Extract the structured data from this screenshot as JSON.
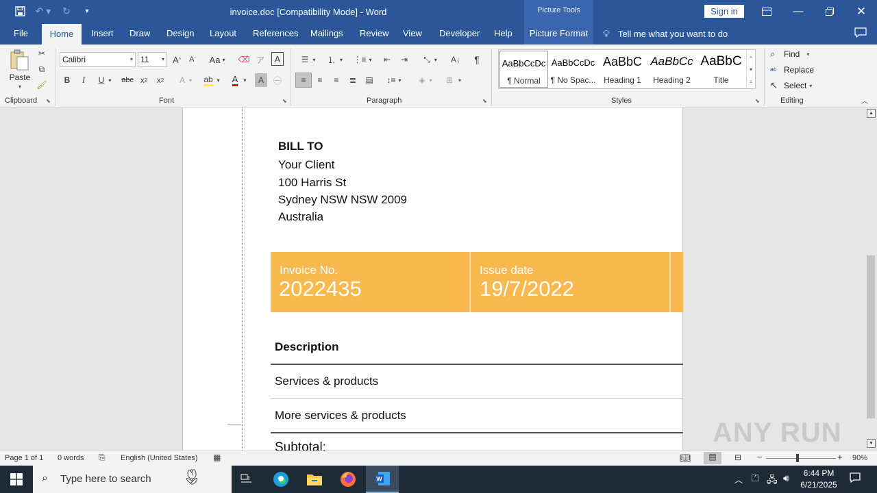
{
  "titlebar": {
    "title": "invoice.doc [Compatibility Mode]  -  Word",
    "picture_tools": "Picture Tools",
    "sign_in": "Sign in"
  },
  "tabs": [
    {
      "label": "File"
    },
    {
      "label": "Home"
    },
    {
      "label": "Insert"
    },
    {
      "label": "Draw"
    },
    {
      "label": "Design"
    },
    {
      "label": "Layout"
    },
    {
      "label": "References"
    },
    {
      "label": "Mailings"
    },
    {
      "label": "Review"
    },
    {
      "label": "View"
    },
    {
      "label": "Developer"
    },
    {
      "label": "Help"
    },
    {
      "label": "Picture Format"
    }
  ],
  "tell_me": "Tell me what you want to do",
  "ribbon": {
    "clipboard": {
      "label": "Clipboard",
      "paste": "Paste"
    },
    "font": {
      "label": "Font",
      "family": "Calibri",
      "size": "11",
      "aa": "Aa"
    },
    "paragraph": {
      "label": "Paragraph"
    },
    "styles": {
      "label": "Styles",
      "items": [
        {
          "sample": "AaBbCcDc",
          "name": "¶ Normal"
        },
        {
          "sample": "AaBbCcDc",
          "name": "¶ No Spac..."
        },
        {
          "sample": "AaBbC",
          "name": "Heading 1"
        },
        {
          "sample": "AaBbCc",
          "name": "Heading 2"
        },
        {
          "sample": "AaBbC",
          "name": "Title"
        }
      ]
    },
    "editing": {
      "label": "Editing",
      "find": "Find",
      "replace": "Replace",
      "select": "Select"
    }
  },
  "document": {
    "bill_to": "BILL TO",
    "client": "Your Client",
    "street": "100 Harris St",
    "city": "Sydney NSW NSW 2009",
    "country": "Australia",
    "invoice_no_label": "Invoice No.",
    "invoice_no": "2022435",
    "issue_date_label": "Issue date",
    "issue_date": "19/7/2022",
    "description": "Description",
    "row1": "Services & products",
    "row2": "More services & products",
    "subtotal": "Subtotal:"
  },
  "statusbar": {
    "page": "Page 1 of 1",
    "words": "0 words",
    "language": "English (United States)",
    "zoom": "90%"
  },
  "taskbar": {
    "search_placeholder": "Type here to search",
    "time": "6:44 PM",
    "date": "6/21/2025"
  },
  "watermark": "ANY RUN",
  "colors": {
    "word_blue": "#2b579a",
    "invoice_band": "#f9b94f"
  }
}
